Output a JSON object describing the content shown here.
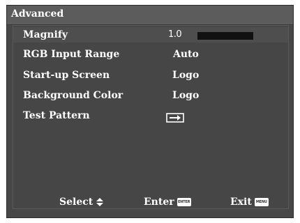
{
  "menu": {
    "title": "Advanced",
    "items": [
      {
        "label": "Magnify",
        "value": "1.0",
        "slider_fraction": 0.0
      },
      {
        "label": "RGB Input Range",
        "value": "Auto"
      },
      {
        "label": "Start-up Screen",
        "value": "Logo"
      },
      {
        "label": "Background Color",
        "value": "Logo"
      },
      {
        "label": "Test Pattern",
        "icon": "enter-arrow-icon"
      }
    ]
  },
  "footer": {
    "select_label": "Select",
    "select_icon": "up-down-arrows-icon",
    "enter_label": "Enter",
    "enter_key_text": "ENTER",
    "exit_label": "Exit",
    "exit_key_text": "MENU"
  },
  "colors": {
    "background": "#474747",
    "header": "#5c5c5c",
    "text": "#ffffff",
    "slider_bar": "#111111"
  }
}
